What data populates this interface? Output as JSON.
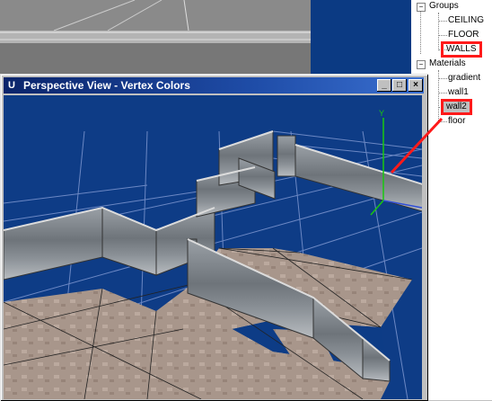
{
  "window": {
    "title": "Perspective View - Vertex Colors",
    "icon_letter": "U",
    "buttons": {
      "minimize": "_",
      "maximize": "□",
      "close": "×"
    }
  },
  "tree": {
    "groups_label": "Groups",
    "groups": [
      "CEILING",
      "FLOOR",
      "WALLS"
    ],
    "materials_label": "Materials",
    "materials": [
      "gradient",
      "wall1",
      "wall2",
      "floor"
    ],
    "expand_symbol": "−"
  },
  "colors": {
    "highlight": "#ff1a1a",
    "viewport_bg": "#0e3c86",
    "title_bar": "#0a246a"
  }
}
